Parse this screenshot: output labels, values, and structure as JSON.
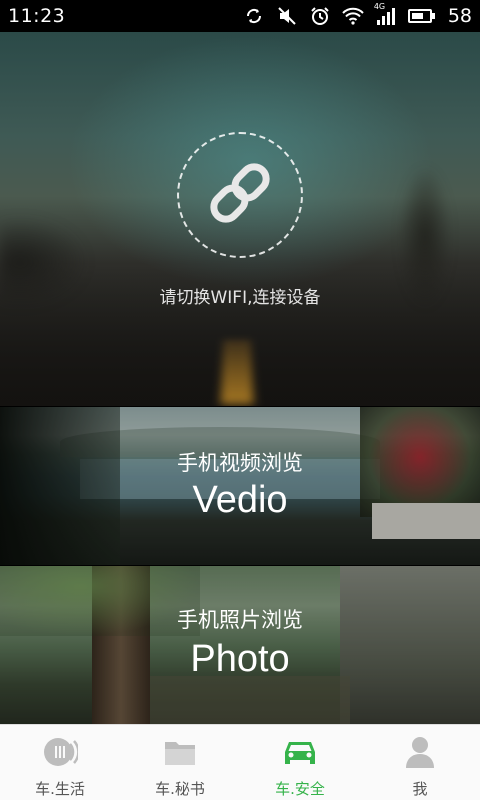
{
  "status_bar": {
    "time": "11:23",
    "network_label": "4G",
    "battery_level": "58"
  },
  "connect": {
    "hint": "请切换WIFI,连接设备",
    "icon": "link-icon"
  },
  "cards": [
    {
      "title": "手机视频浏览",
      "subtitle": "Vedio"
    },
    {
      "title": "手机照片浏览",
      "subtitle": "Photo"
    }
  ],
  "tabs": [
    {
      "label": "车.生活",
      "icon": "car-life-icon",
      "active": false
    },
    {
      "label": "车.秘书",
      "icon": "folder-icon",
      "active": false
    },
    {
      "label": "车.安全",
      "icon": "car-icon",
      "active": true
    },
    {
      "label": "我",
      "icon": "person-icon",
      "active": false
    }
  ],
  "colors": {
    "accent": "#35b34a",
    "tab_inactive": "#bdbdbd"
  }
}
